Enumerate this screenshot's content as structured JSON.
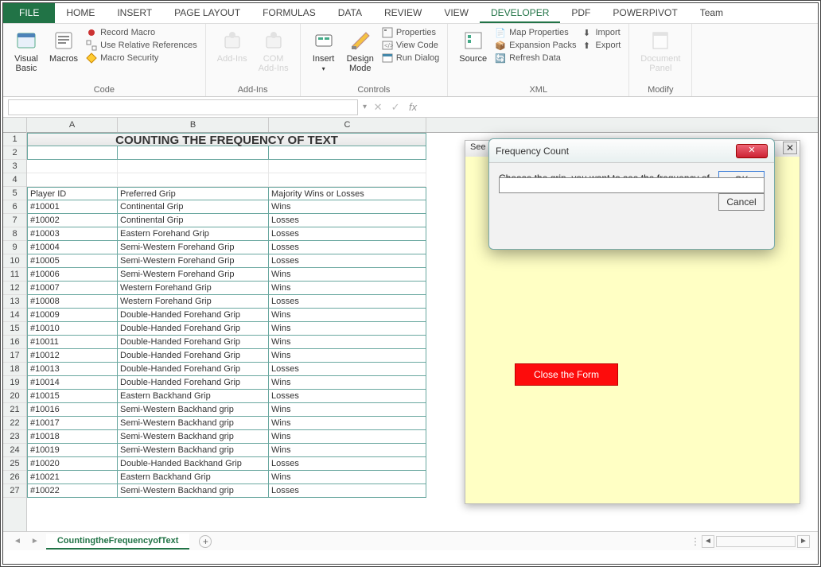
{
  "ribbon_tabs": {
    "file": "FILE",
    "home": "HOME",
    "insert": "INSERT",
    "page_layout": "PAGE LAYOUT",
    "formulas": "FORMULAS",
    "data": "DATA",
    "review": "REVIEW",
    "view": "VIEW",
    "developer": "DEVELOPER",
    "pdf": "PDF",
    "powerpivot": "POWERPIVOT",
    "team": "Team"
  },
  "groups": {
    "code": {
      "label": "Code",
      "visual_basic": "Visual\nBasic",
      "macros": "Macros",
      "record_macro": "Record Macro",
      "use_relative": "Use Relative References",
      "macro_security": "Macro Security"
    },
    "addins": {
      "label": "Add-Ins",
      "addins": "Add-Ins",
      "com_addins": "COM\nAdd-Ins"
    },
    "controls": {
      "label": "Controls",
      "insert": "Insert",
      "design_mode": "Design\nMode",
      "properties": "Properties",
      "view_code": "View Code",
      "run_dialog": "Run Dialog"
    },
    "xml": {
      "label": "XML",
      "source": "Source",
      "map_properties": "Map Properties",
      "expansion_packs": "Expansion Packs",
      "refresh_data": "Refresh Data",
      "import": "Import",
      "export": "Export"
    },
    "modify": {
      "label": "Modify",
      "document_panel": "Document\nPanel"
    }
  },
  "formula_bar": {
    "name_box": "",
    "fx_label": "fx"
  },
  "columns": {
    "A": "A",
    "B": "B",
    "C": "C"
  },
  "sheet_title": "COUNTING THE FREQUENCY OF TEXT",
  "headers": {
    "player_id": "Player ID",
    "preferred_grip": "Preferred Grip",
    "majority": "Majority Wins or Losses"
  },
  "rows": [
    {
      "id": "#10001",
      "grip": "Continental Grip",
      "result": "Wins"
    },
    {
      "id": "#10002",
      "grip": "Continental Grip",
      "result": "Losses"
    },
    {
      "id": "#10003",
      "grip": "Eastern Forehand Grip",
      "result": "Losses"
    },
    {
      "id": "#10004",
      "grip": "Semi-Western Forehand Grip",
      "result": "Losses"
    },
    {
      "id": "#10005",
      "grip": "Semi-Western Forehand Grip",
      "result": "Losses"
    },
    {
      "id": "#10006",
      "grip": "Semi-Western Forehand Grip",
      "result": "Wins"
    },
    {
      "id": "#10007",
      "grip": "Western Forehand Grip",
      "result": "Wins"
    },
    {
      "id": "#10008",
      "grip": "Western Forehand Grip",
      "result": "Losses"
    },
    {
      "id": "#10009",
      "grip": "Double-Handed Forehand Grip",
      "result": "Wins"
    },
    {
      "id": "#10010",
      "grip": "Double-Handed Forehand Grip",
      "result": "Wins"
    },
    {
      "id": "#10011",
      "grip": "Double-Handed Forehand Grip",
      "result": "Wins"
    },
    {
      "id": "#10012",
      "grip": "Double-Handed Forehand Grip",
      "result": "Wins"
    },
    {
      "id": "#10013",
      "grip": "Double-Handed Forehand Grip",
      "result": "Losses"
    },
    {
      "id": "#10014",
      "grip": "Double-Handed Forehand Grip",
      "result": "Wins"
    },
    {
      "id": "#10015",
      "grip": "Eastern Backhand Grip",
      "result": "Losses"
    },
    {
      "id": "#10016",
      "grip": "Semi-Western Backhand grip",
      "result": "Wins"
    },
    {
      "id": "#10017",
      "grip": "Semi-Western Backhand grip",
      "result": "Wins"
    },
    {
      "id": "#10018",
      "grip": "Semi-Western Backhand grip",
      "result": "Wins"
    },
    {
      "id": "#10019",
      "grip": "Semi-Western Backhand grip",
      "result": "Wins"
    },
    {
      "id": "#10020",
      "grip": "Double-Handed Backhand Grip",
      "result": "Losses"
    },
    {
      "id": "#10021",
      "grip": "Eastern Backhand Grip",
      "result": "Wins"
    },
    {
      "id": "#10022",
      "grip": "Semi-Western Backhand grip",
      "result": "Losses"
    }
  ],
  "sheet_tab": "CountingtheFrequencyofText",
  "user_form": {
    "title": "See",
    "close_button": "Close the Form"
  },
  "dialog": {
    "title": "Frequency Count",
    "prompt": "Choose the grip, you want to see the frequency of",
    "ok": "OK",
    "cancel": "Cancel",
    "input_value": ""
  }
}
